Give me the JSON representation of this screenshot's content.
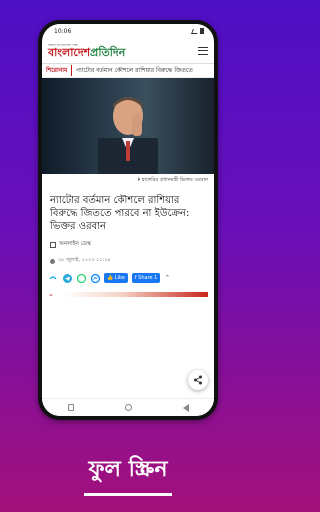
{
  "status_bar": {
    "time": "10:06"
  },
  "app": {
    "logo_tagline": "আমরা বাংলাদেশের পক্ষে",
    "logo_part1": "বাংলাদেশ",
    "logo_part2": "প্রতিদিন",
    "menu_icon": "hamburger-icon"
  },
  "ticker": {
    "label": "শিরোনাম",
    "text": "ন্যাটোর বর্তমান কৌশলে রাশিয়ার বিরুদ্ধে জিততে"
  },
  "article": {
    "image_caption": "হাঙ্গেরির প্রধানমন্ত্রী ভিক্তর ওরবান",
    "headline": "ন্যাটোর বর্তমান কৌশলে রাশিয়ার বিরুদ্ধে জিততে পারবে না ইউক্রেন: ভিক্তর ওরবান",
    "author": "অনলাইন ডেস্ক",
    "date": "২৮ জুলাই, ২০২৩ ২১:১৮"
  },
  "share": {
    "fb_like_label": "Like",
    "fb_share_label": "Share 1",
    "icons": [
      "chevron-down-icon",
      "telegram-icon",
      "whatsapp-icon",
      "messenger-icon",
      "twitter-icon"
    ]
  },
  "banner": {
    "title": "ফুল স্ক্রিন"
  },
  "colors": {
    "brand_red": "#c4161c",
    "brand_green": "#1a7f3c",
    "facebook_blue": "#1877f2",
    "bg_top": "#4d0fc4",
    "bg_bottom": "#a3107a"
  }
}
